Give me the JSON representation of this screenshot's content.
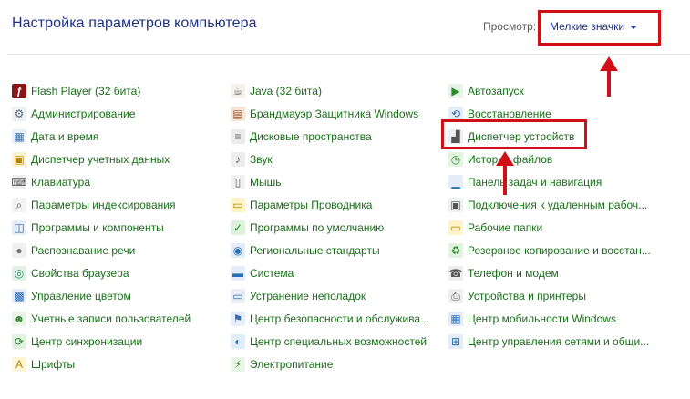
{
  "header": {
    "title": "Настройка параметров компьютера",
    "view_label": "Просмотр:",
    "view_value": "Мелкие значки"
  },
  "columns": [
    [
      {
        "label": "Flash Player (32 бита)",
        "icon": "flash-icon"
      },
      {
        "label": "Администрирование",
        "icon": "gears-icon"
      },
      {
        "label": "Дата и время",
        "icon": "calendar-clock-icon"
      },
      {
        "label": "Диспетчер учетных данных",
        "icon": "credential-vault-icon"
      },
      {
        "label": "Клавиатура",
        "icon": "keyboard-icon"
      },
      {
        "label": "Параметры индексирования",
        "icon": "indexing-icon"
      },
      {
        "label": "Программы и компоненты",
        "icon": "programs-icon"
      },
      {
        "label": "Распознавание речи",
        "icon": "microphone-icon"
      },
      {
        "label": "Свойства браузера",
        "icon": "internet-options-icon"
      },
      {
        "label": "Управление цветом",
        "icon": "color-management-icon"
      },
      {
        "label": "Учетные записи пользователей",
        "icon": "users-icon"
      },
      {
        "label": "Центр синхронизации",
        "icon": "sync-icon"
      },
      {
        "label": "Шрифты",
        "icon": "fonts-icon"
      }
    ],
    [
      {
        "label": "Java (32 бита)",
        "icon": "java-icon"
      },
      {
        "label": "Брандмауэр Защитника Windows",
        "icon": "firewall-icon"
      },
      {
        "label": "Дисковые пространства",
        "icon": "storage-spaces-icon"
      },
      {
        "label": "Звук",
        "icon": "speaker-icon"
      },
      {
        "label": "Мышь",
        "icon": "mouse-icon"
      },
      {
        "label": "Параметры Проводника",
        "icon": "folder-options-icon"
      },
      {
        "label": "Программы по умолчанию",
        "icon": "default-programs-icon"
      },
      {
        "label": "Региональные стандарты",
        "icon": "region-icon"
      },
      {
        "label": "Система",
        "icon": "system-icon"
      },
      {
        "label": "Устранение неполадок",
        "icon": "troubleshooting-icon"
      },
      {
        "label": "Центр безопасности и обслужива...",
        "icon": "security-flag-icon"
      },
      {
        "label": "Центр специальных возможностей",
        "icon": "ease-of-access-icon"
      },
      {
        "label": "Электропитание",
        "icon": "power-options-icon"
      }
    ],
    [
      {
        "label": "Автозапуск",
        "icon": "autoplay-icon"
      },
      {
        "label": "Восстановление",
        "icon": "recovery-icon"
      },
      {
        "label": "Диспетчер устройств",
        "icon": "device-manager-icon"
      },
      {
        "label": "История файлов",
        "icon": "file-history-icon"
      },
      {
        "label": "Панель задач и навигация",
        "icon": "taskbar-icon"
      },
      {
        "label": "Подключения к удаленным рабоч...",
        "icon": "remote-desktop-icon"
      },
      {
        "label": "Рабочие папки",
        "icon": "work-folders-icon"
      },
      {
        "label": "Резервное копирование и восстан...",
        "icon": "backup-icon"
      },
      {
        "label": "Телефон и модем",
        "icon": "phone-modem-icon"
      },
      {
        "label": "Устройства и принтеры",
        "icon": "printer-icon"
      },
      {
        "label": "Центр мобильности Windows",
        "icon": "mobility-center-icon"
      },
      {
        "label": "Центр управления сетями и общи...",
        "icon": "network-icon"
      }
    ]
  ],
  "colors": {
    "title": "#1e3287",
    "link": "#1a6e1a",
    "highlight": "#d10f16"
  }
}
